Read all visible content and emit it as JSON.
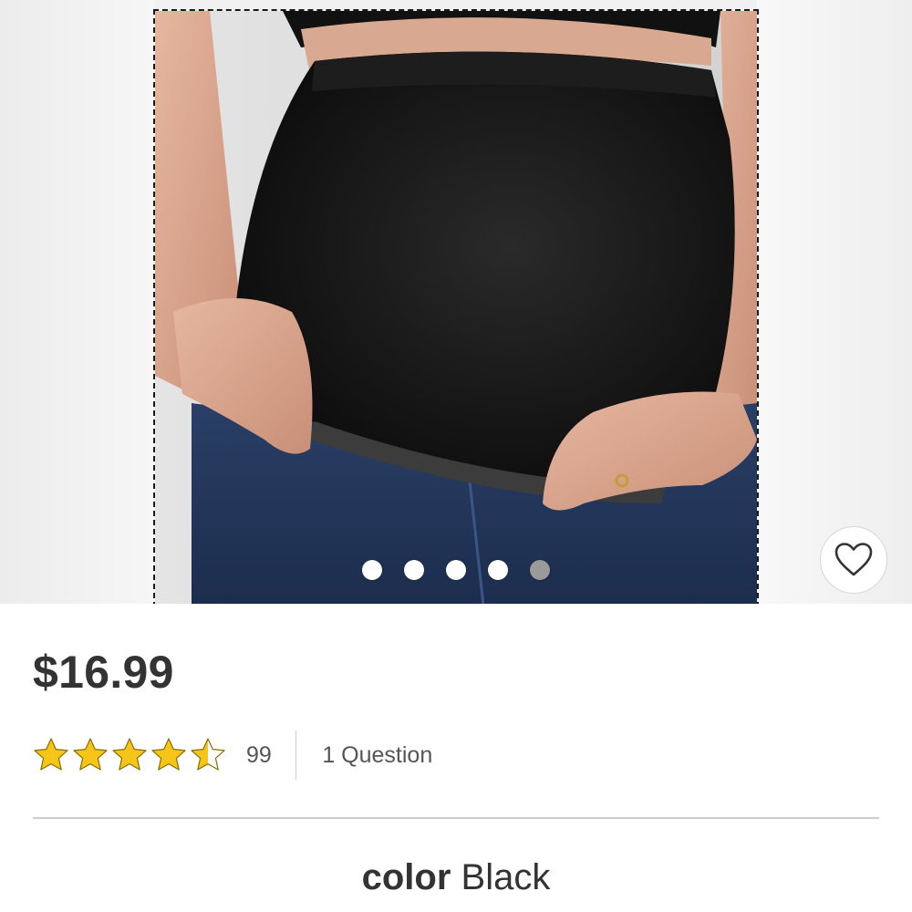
{
  "product": {
    "price": "$16.99",
    "rating": 4.5,
    "rating_max": 5,
    "review_count": "99",
    "questions": "1 Question",
    "color_label": "color",
    "color_value": "Black"
  },
  "carousel": {
    "image_count": 5,
    "active_index": 4
  },
  "icons": {
    "favorite": "heart-outline-icon",
    "star": "star-icon"
  },
  "colors": {
    "star_fill": "#F5C518",
    "price_text": "#333333",
    "active_dot": "#9a9a9a"
  }
}
